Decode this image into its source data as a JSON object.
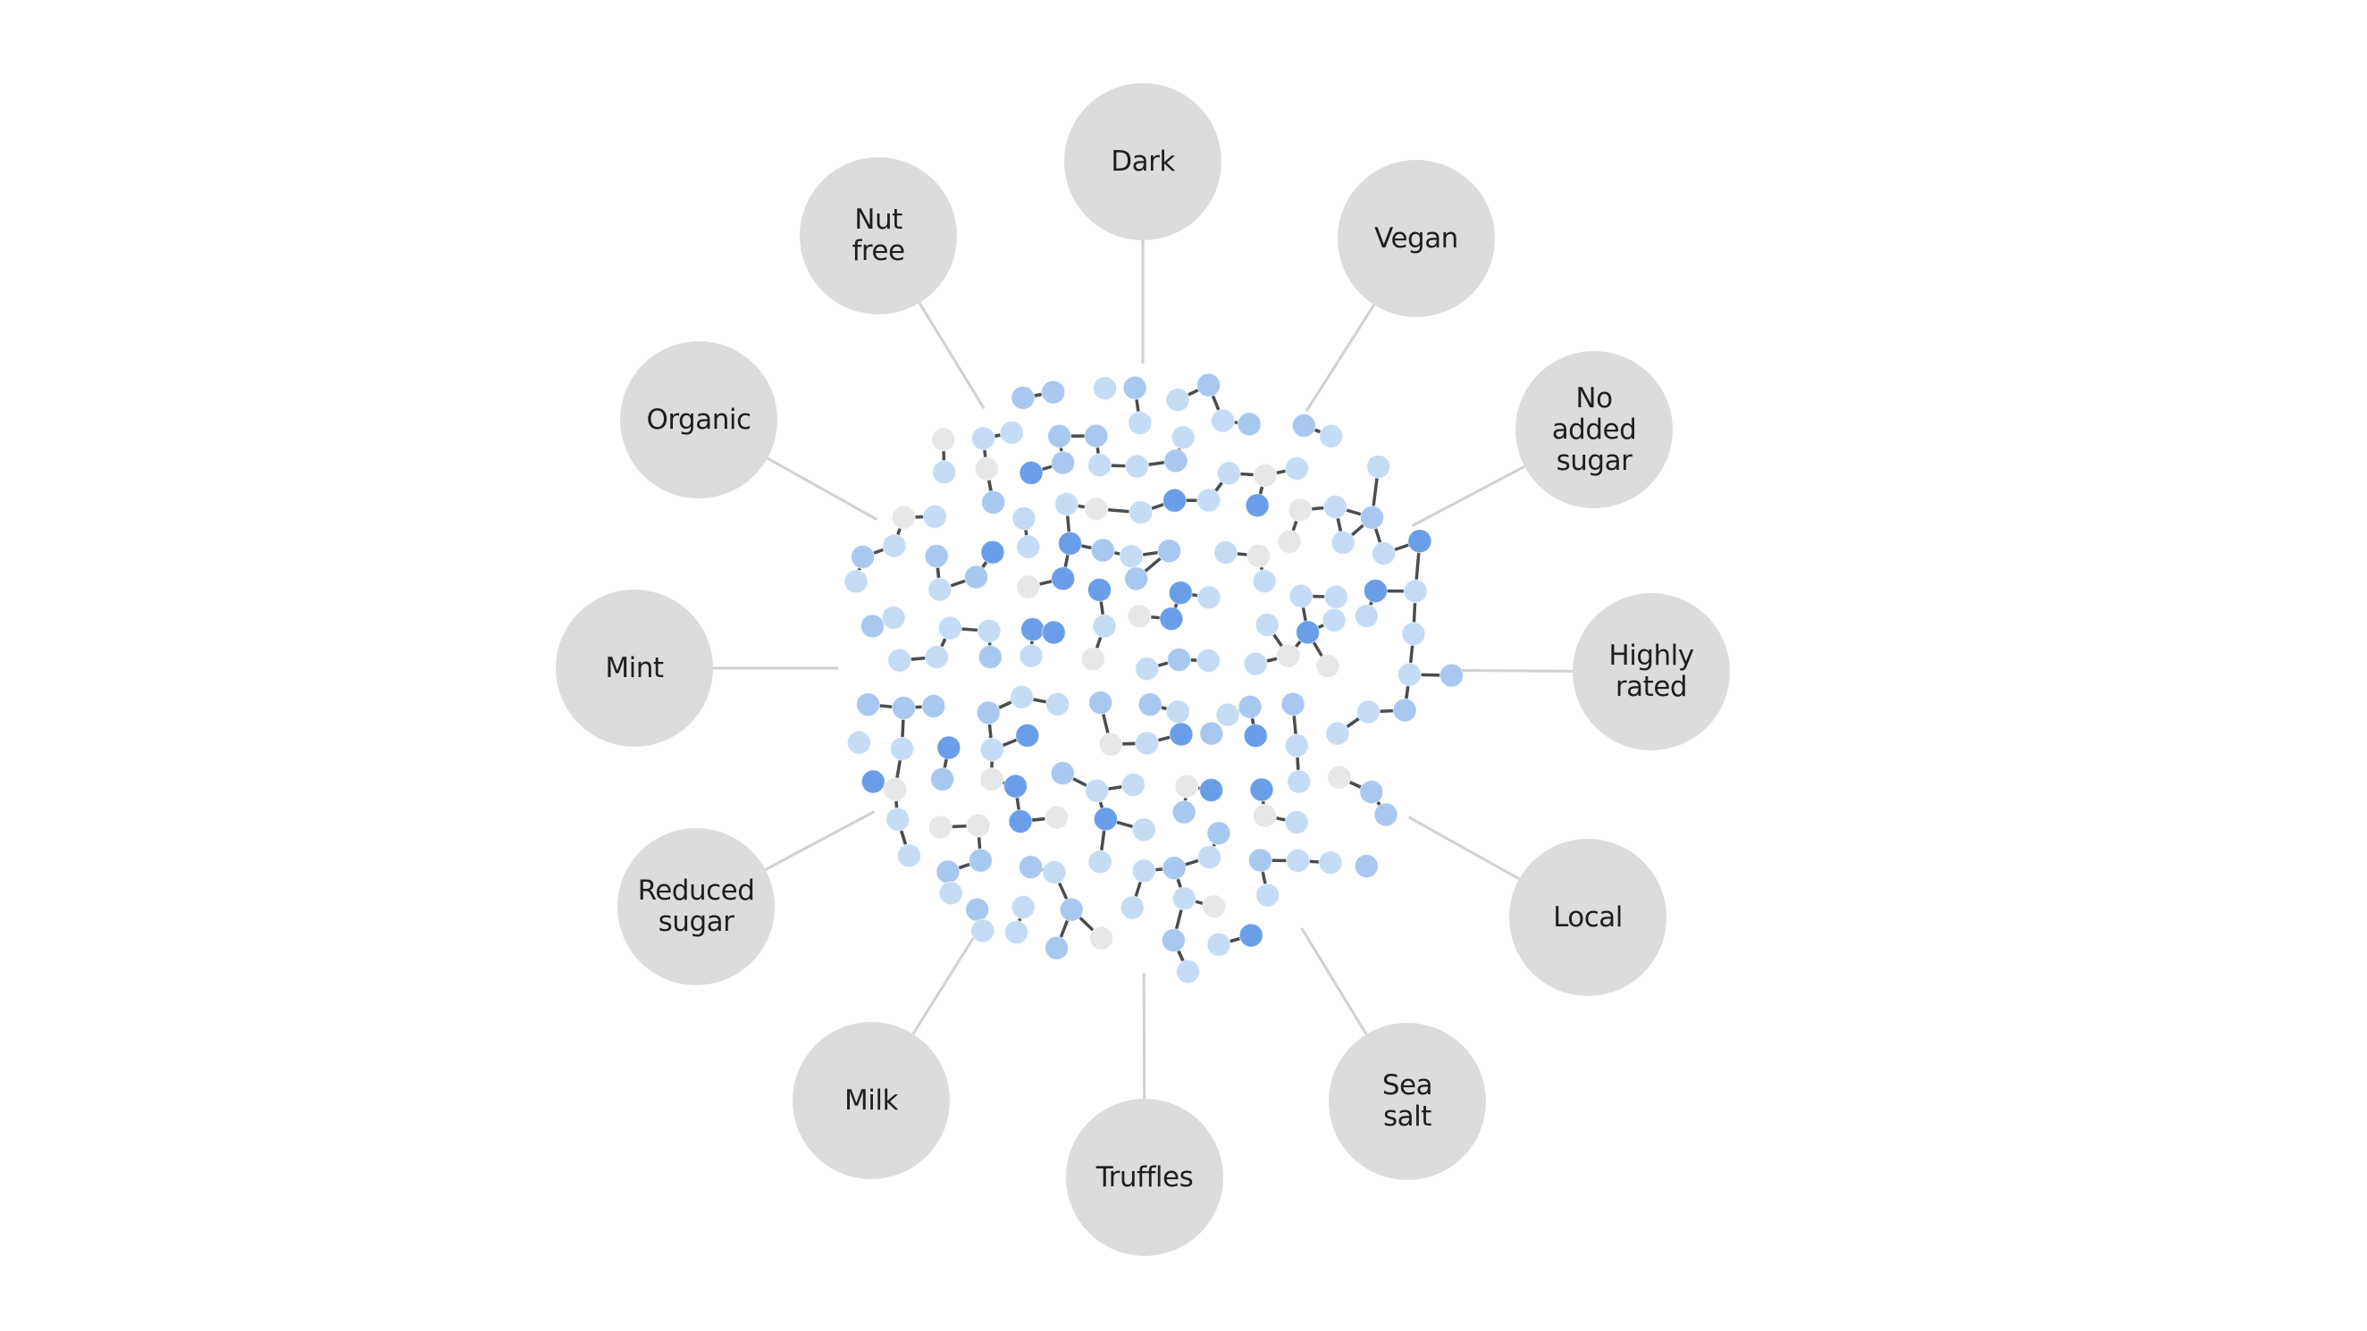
{
  "diagram": {
    "description": "Attribute network: central cluster of connected product nodes linked to attribute bubbles",
    "colors": {
      "background": "#ffffff",
      "bubble_fill": "#dadcdd",
      "bubble_text": "#1f1f1f",
      "spoke_line": "#cfd1d2",
      "edge_line": "#4a4d50",
      "node_light": "#c6dcf5",
      "node_medium": "#a9c8f0",
      "node_dark": "#6a9ee8",
      "node_gray": "#e6e8e8"
    },
    "attributes": [
      {
        "id": "dark",
        "label": "Dark"
      },
      {
        "id": "vegan",
        "label": "Vegan"
      },
      {
        "id": "no-added-sugar",
        "label": "No\nadded\nsugar"
      },
      {
        "id": "highly-rated",
        "label": "Highly\nrated"
      },
      {
        "id": "local",
        "label": "Local"
      },
      {
        "id": "sea-salt",
        "label": "Sea\nsalt"
      },
      {
        "id": "truffles",
        "label": "Truffles"
      },
      {
        "id": "milk",
        "label": "Milk"
      },
      {
        "id": "reduced-sugar",
        "label": "Reduced\nsugar"
      },
      {
        "id": "mint",
        "label": "Mint"
      },
      {
        "id": "organic",
        "label": "Organic"
      },
      {
        "id": "nut-free",
        "label": "Nut\nfree"
      }
    ]
  }
}
